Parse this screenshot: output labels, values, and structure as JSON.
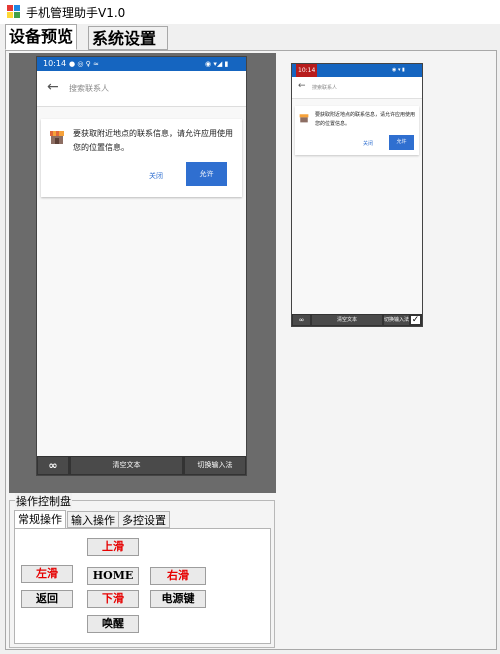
{
  "window": {
    "title": "手机管理助手V1.0"
  },
  "main_tabs": [
    {
      "label": "设备预览"
    },
    {
      "label": "系统设置"
    }
  ],
  "device_screen": {
    "status_time": "10:14",
    "search_placeholder": "搜索联系人",
    "permission_message": "要获取附近地点的联系信息，请允许应用使用您的位置信息。",
    "close_label": "关闭",
    "allow_label": "允许"
  },
  "device_toolbar": {
    "infinity_label": "∞",
    "clear_text_label": "清空文本",
    "switch_ime_label": "切换输入法"
  },
  "control_panel": {
    "group_title": "操作控制盘",
    "tabs": [
      {
        "label": "常规操作"
      },
      {
        "label": "输入操作"
      },
      {
        "label": "多控设置"
      }
    ],
    "buttons": {
      "swipe_up": "上滑",
      "swipe_left": "左滑",
      "home": "HOME",
      "swipe_right": "右滑",
      "back": "返回",
      "swipe_down": "下滑",
      "power": "电源键",
      "wake": "唤醒"
    }
  },
  "colors": {
    "accent_red": "#e60000",
    "status_blue": "#1565c0",
    "allow_button_blue": "#2f6fd0"
  }
}
